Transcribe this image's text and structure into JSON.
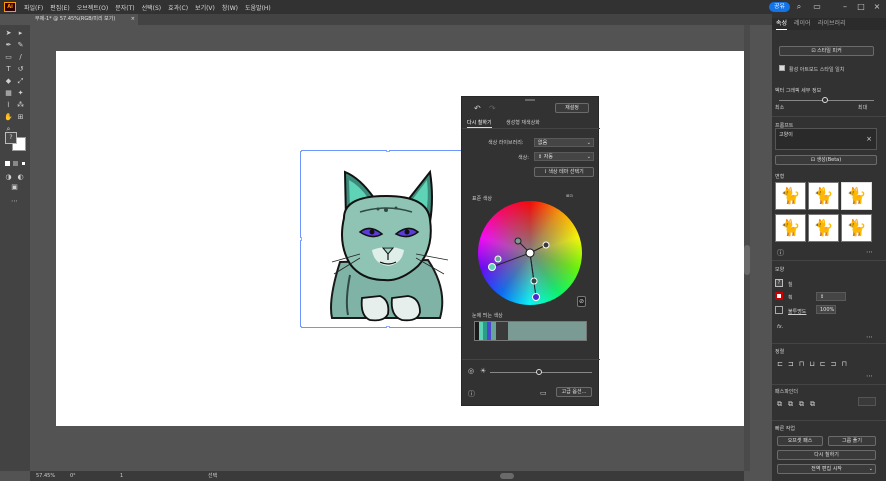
{
  "app": {
    "logo_text": "Ai",
    "menu": [
      "파일(F)",
      "편집(E)",
      "오브젝트(O)",
      "문자(T)",
      "선택(S)",
      "효과(C)",
      "보기(V)",
      "창(W)",
      "도움말(H)"
    ],
    "share_label": "공유"
  },
  "document_tab": {
    "title": "무제-1* @ 57.45%(RGB/미리 보기)",
    "close": "×"
  },
  "status": {
    "zoom": "57.45%",
    "rotation": "0°",
    "artboard": "1",
    "mode": "선택"
  },
  "recolor": {
    "reset_label": "재설정",
    "tabs": [
      "다시 칠하기",
      "생성형 재색상화"
    ],
    "library_label": "색상 라이브러리:",
    "library_value": "없음",
    "colors_label": "색상:",
    "colors_value": "자동",
    "theme_button": "색상 테마 선택기",
    "prominent_label": "표준 색상",
    "prominent_title": "눈에 띄는 색상",
    "advanced_button": "고급 옵션...",
    "wheel_colors": [
      "#ff0000",
      "#ffcc00",
      "#66ff00",
      "#00ffcc",
      "#0066ff",
      "#cc00ff",
      "#ff0066"
    ],
    "prominent_swatches": [
      {
        "color": "#1a1a1a",
        "share": 0.04
      },
      {
        "color": "#5fd3b5",
        "share": 0.03
      },
      {
        "color": "#2a9e86",
        "share": 0.04
      },
      {
        "color": "#4a4ad0",
        "share": 0.03
      },
      {
        "color": "#6aa498",
        "share": 0.05
      },
      {
        "color": "#3a3a3a",
        "share": 0.11
      },
      {
        "color": "#7a9a94",
        "share": 0.7
      }
    ]
  },
  "right_panel": {
    "tabs": [
      "속성",
      "레이어",
      "라이브러리"
    ],
    "style_button": "스타일 피커",
    "style_checkbox": "활성 아트보드 스타일 일치",
    "vector_detail": "벡터 그래픽 세부 정보",
    "slider_min": "최소",
    "slider_max": "최대",
    "prompt_label": "프롬프트",
    "prompt_value": "고양이",
    "generate_button": "생성(Beta)",
    "variations_label": "변형",
    "appearance_label": "모양",
    "fill_label": "칠",
    "stroke_label": "획",
    "opacity_label": "불투명도",
    "opacity_value": "100%",
    "fx_label": "fx.",
    "align_label": "정렬",
    "pathfinder_label": "패스파인더",
    "quick_actions_label": "빠른 작업",
    "outline_button": "오프셋 패스",
    "group_button": "그룹 풀기",
    "recolor_button": "다시 칠하기",
    "start_global_button": "전역 편집 시작"
  }
}
